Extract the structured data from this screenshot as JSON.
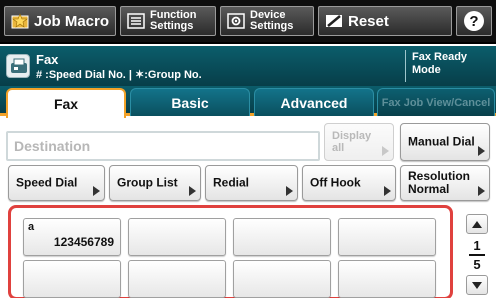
{
  "topbar": {
    "job_macro": "Job Macro",
    "function_settings": "Function\nSettings",
    "device_settings": "Device\nSettings",
    "reset": "Reset",
    "help": "?"
  },
  "header": {
    "title": "Fax",
    "subtitle": "# :Speed Dial No. | ✶:Group No.",
    "status": "Fax Ready\nMode"
  },
  "tabs": [
    {
      "label": "Fax",
      "active": true
    },
    {
      "label": "Basic",
      "active": false
    },
    {
      "label": "Advanced",
      "active": false
    },
    {
      "label": "Fax Job View/Cancel",
      "active": false,
      "disabled": true
    }
  ],
  "destination": {
    "placeholder": "Destination",
    "display_all": "Display\nall",
    "manual_dial": "Manual Dial"
  },
  "actions": {
    "speed_dial": "Speed Dial",
    "group_list": "Group List",
    "redial": "Redial",
    "off_hook": "Off Hook",
    "resolution": "Resolution\nNormal"
  },
  "speed_dial_entries": [
    {
      "name": "a",
      "number": "123456789"
    },
    {
      "name": "",
      "number": ""
    },
    {
      "name": "",
      "number": ""
    },
    {
      "name": "",
      "number": ""
    },
    {
      "name": "",
      "number": ""
    },
    {
      "name": "",
      "number": ""
    },
    {
      "name": "",
      "number": ""
    },
    {
      "name": "",
      "number": ""
    }
  ],
  "pager": {
    "current": "1",
    "total": "5"
  },
  "icons": {
    "job_macro": "job-macro-icon",
    "function_settings": "list-icon",
    "device_settings": "settings-icon",
    "reset": "reset-icon",
    "help": "help-icon",
    "fax": "fax-icon"
  },
  "colors": {
    "top_bar": "#0e0e0e",
    "header": "#0b5d6b",
    "tab_accent": "#f2a229",
    "selection_border": "#e0413e"
  }
}
